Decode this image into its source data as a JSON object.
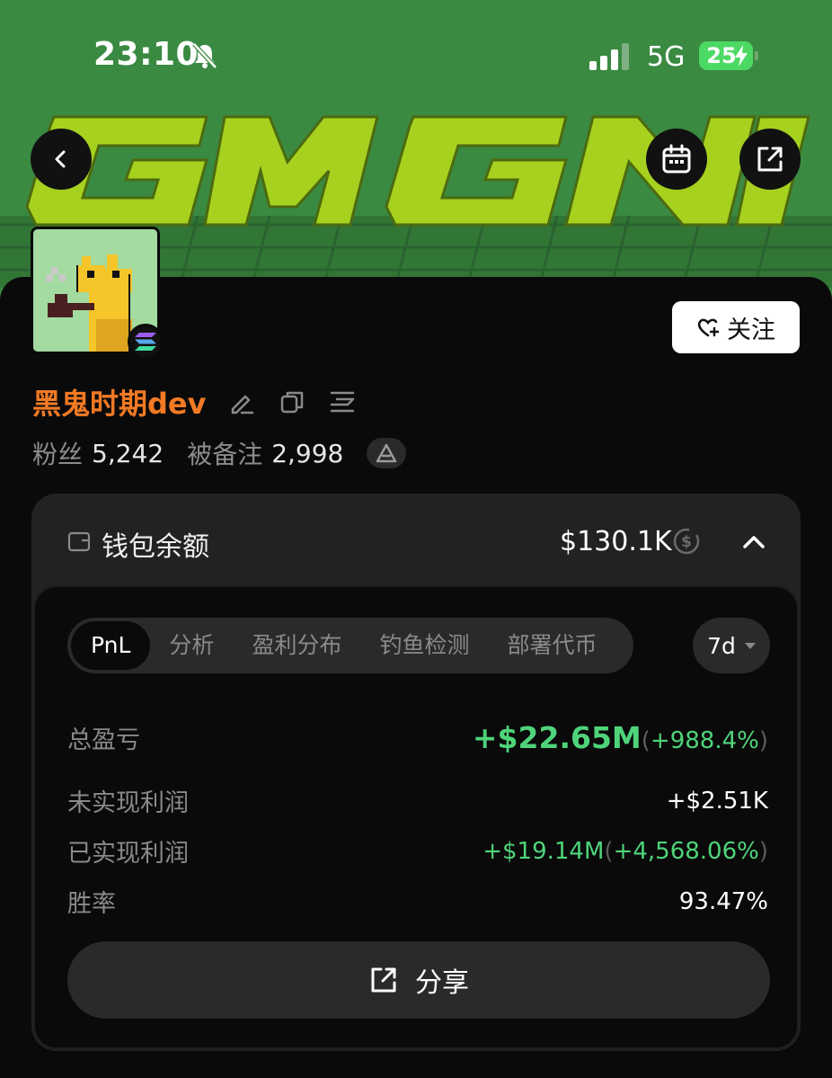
{
  "status_bar": {
    "time": "23:10",
    "network": "5G",
    "battery": "25"
  },
  "banner": {
    "art_text": "GMGN",
    "background_color": "#3a8a42",
    "art_color": "#a6d21f"
  },
  "profile": {
    "name": "黑鬼时期dev",
    "follow_label": "关注",
    "followers_label": "粉丝",
    "followers_value": "5,242",
    "noted_label": "被备注",
    "noted_value": "2,998"
  },
  "wallet": {
    "label": "钱包余额",
    "amount": "$130.1K"
  },
  "tabs": [
    {
      "label": "PnL",
      "active": true
    },
    {
      "label": "分析",
      "active": false
    },
    {
      "label": "盈利分布",
      "active": false
    },
    {
      "label": "钓鱼检测",
      "active": false
    },
    {
      "label": "部署代币",
      "active": false
    }
  ],
  "period": {
    "selected": "7d"
  },
  "metrics": {
    "total_pnl": {
      "label": "总盈亏",
      "value": "+$22.65M",
      "percent": "+988.4%"
    },
    "unrealized": {
      "label": "未实现利润",
      "value": "+$2.51K"
    },
    "realized": {
      "label": "已实现利润",
      "value": "+$19.14M",
      "percent": "+4,568.06%"
    },
    "win_rate": {
      "label": "胜率",
      "value": "93.47%"
    }
  },
  "share_label": "分享",
  "colors": {
    "accent_orange": "#f27a24",
    "positive_green": "#4fd47a"
  }
}
